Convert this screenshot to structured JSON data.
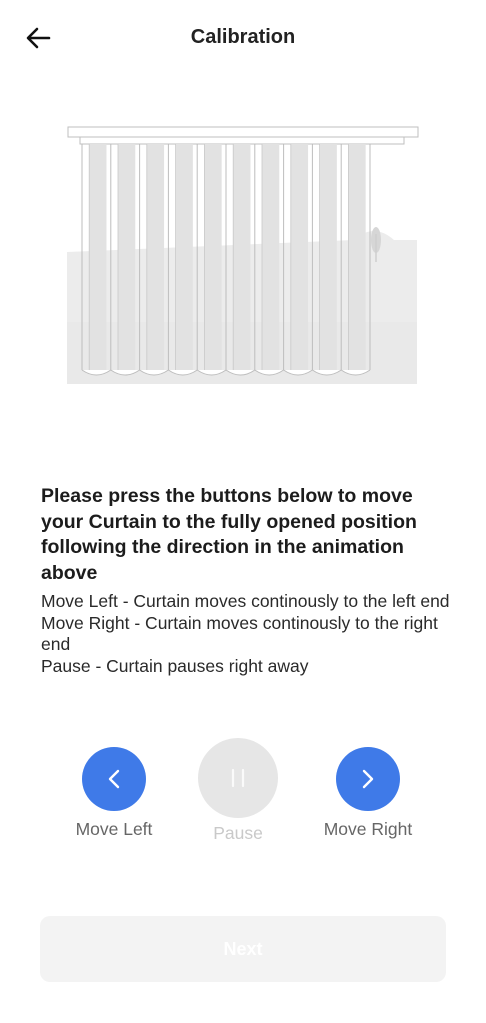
{
  "header": {
    "title": "Calibration"
  },
  "instructions": {
    "heading": "Please press the buttons below to move your Curtain to the fully opened position following the direction in the animation above",
    "lines": [
      "Move Left - Curtain moves continously to the left end",
      "Move Right - Curtain moves continously to the right end",
      "Pause - Curtain pauses right away"
    ]
  },
  "controls": {
    "left_label": "Move Left",
    "pause_label": "Pause",
    "right_label": "Move Right"
  },
  "footer": {
    "next_label": "Next"
  },
  "colors": {
    "accent": "#3f7ae8",
    "disabled": "#e6e6e6"
  }
}
